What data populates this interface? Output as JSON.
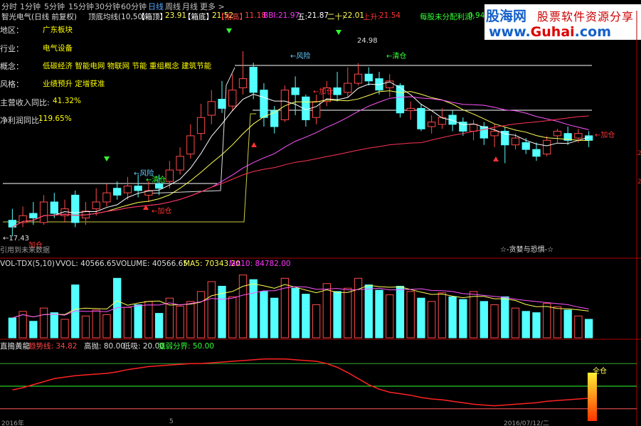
{
  "tabs": [
    "分时",
    "1分钟",
    "5分钟",
    "15分钟",
    "30分钟",
    "60分钟",
    "日线",
    "周线",
    "月线",
    "更多 >"
  ],
  "active_tab": "日线",
  "info_bar": {
    "name": "智光电气(日线 前复权)",
    "formula": "顶底均线(10,50)",
    "top_label": "【箱顶】",
    "top_value": "23.91",
    "bottom_label": "【箱底】",
    "bottom_value": "21.52",
    "target_label": "【指高】",
    "target_value": "11.18",
    "bbi_label": "BBI:",
    "bbi_value": "21.97",
    "five_label": "五:",
    "five_value": "21.87",
    "twenty_label": "二十:",
    "twenty_value": "22.01",
    "up_label": "上升:",
    "up_value": "21.54",
    "dist_label": "每股未分配利润:",
    "dist_value": "0.94"
  },
  "side_info": [
    {
      "key": "地区：",
      "value": "广东板块"
    },
    {
      "key": "行业：",
      "value": "电气设备"
    },
    {
      "key": "概念：",
      "value": "低碳经济 智能电网 物联网 节能 重组概念 建筑节能"
    },
    {
      "key": "风格：",
      "value": "业绩预升 定增获准"
    },
    {
      "key": "主营收入同比:",
      "value": "41.32%"
    },
    {
      "key": "净利润同比:",
      "value": "119.65%"
    }
  ],
  "banner": {
    "site_cn": "股海网",
    "slogan": "股票软件资源分享",
    "url_prefix": "www.",
    "url_main": "Guhai",
    "url_suffix": ".com"
  },
  "annotations": {
    "risk1": "←风险",
    "clear1": "←清仓",
    "add1": "←加仓",
    "risk2": "←风险",
    "add2": "←加仓",
    "clear2": "←清仓",
    "peak": "24.98",
    "low": "←17.43",
    "add_left": "加仓",
    "future": "引用到未来数据",
    "add_right": "←加仓",
    "motto": "☆-贪婪与恐惧-☆"
  },
  "volume_header": {
    "name": "VOL-TDX(5,10)",
    "vvol": "VVOL: 40566.65",
    "volume": "VOLUME: 40566.65",
    "ma5": "MA5: 70343.20",
    "ma10": "MA10: 84782.00"
  },
  "indicator_header": {
    "name": "直搗黃龍",
    "trend": "趋势线: 34.82",
    "high": "高抛: 80.00",
    "low": "低吸: 20.00",
    "strength": "强弱分界: 50.00",
    "full_pos": "全仓"
  },
  "bottom_axis": [
    "2016年",
    "5",
    "2016/07/12/二"
  ],
  "right_axis": [
    "2",
    "2"
  ],
  "chart_data": {
    "type": "candlestick",
    "candles": [
      [
        18.1,
        17.8,
        18.6,
        17.4
      ],
      [
        18.0,
        18.3,
        18.7,
        17.8
      ],
      [
        18.4,
        18.2,
        18.9,
        17.9
      ],
      [
        18.0,
        18.9,
        19.2,
        17.9
      ],
      [
        18.9,
        18.4,
        19.3,
        18.2
      ],
      [
        18.3,
        18.6,
        19.0,
        18.0
      ],
      [
        19.2,
        18.0,
        19.4,
        17.8
      ],
      [
        18.2,
        18.5,
        18.9,
        17.9
      ],
      [
        18.6,
        18.9,
        19.5,
        18.3
      ],
      [
        18.9,
        19.3,
        19.7,
        18.7
      ],
      [
        19.5,
        19.2,
        19.8,
        19.0
      ],
      [
        19.3,
        19.6,
        20.0,
        19.0
      ],
      [
        19.6,
        19.4,
        20.1,
        19.1
      ],
      [
        19.2,
        19.4,
        19.8,
        18.9
      ],
      [
        19.7,
        19.5,
        20.1,
        19.2
      ],
      [
        19.8,
        20.3,
        20.7,
        19.5
      ],
      [
        20.3,
        20.9,
        21.3,
        20.1
      ],
      [
        21.0,
        21.8,
        22.3,
        20.8
      ],
      [
        21.9,
        22.6,
        23.2,
        21.6
      ],
      [
        22.7,
        23.3,
        23.8,
        22.3
      ],
      [
        23.4,
        23.0,
        24.2,
        22.8
      ],
      [
        23.1,
        23.8,
        24.5,
        22.9
      ],
      [
        23.9,
        24.3,
        25.5,
        23.6
      ],
      [
        24.8,
        23.7,
        25.0,
        23.4
      ],
      [
        23.8,
        22.6,
        24.1,
        22.2
      ],
      [
        22.9,
        22.2,
        23.1,
        21.9
      ],
      [
        22.5,
        23.8,
        24.0,
        22.4
      ],
      [
        23.9,
        23.6,
        24.4,
        22.7
      ],
      [
        23.5,
        22.5,
        23.6,
        22.2
      ],
      [
        22.6,
        23.3,
        23.6,
        22.3
      ],
      [
        23.3,
        23.9,
        24.2,
        23.1
      ],
      [
        23.9,
        23.6,
        24.6,
        23.3
      ],
      [
        23.7,
        24.1,
        24.8,
        23.5
      ],
      [
        24.1,
        24.5,
        24.98,
        24.0
      ],
      [
        24.5,
        24.2,
        24.8,
        24.0
      ],
      [
        24.3,
        23.8,
        24.6,
        23.6
      ],
      [
        23.9,
        24.2,
        24.5,
        23.5
      ],
      [
        24.0,
        22.8,
        24.1,
        22.6
      ],
      [
        22.9,
        23.0,
        23.3,
        22.5
      ],
      [
        23.0,
        22.1,
        23.2,
        22.0
      ],
      [
        22.2,
        22.4,
        22.7,
        21.9
      ],
      [
        22.3,
        22.6,
        23.0,
        22.1
      ],
      [
        22.7,
        22.3,
        22.9,
        22.0
      ],
      [
        22.4,
        22.0,
        22.6,
        21.8
      ],
      [
        22.0,
        22.3,
        22.5,
        21.6
      ],
      [
        22.2,
        21.7,
        22.4,
        21.4
      ],
      [
        21.8,
        22.0,
        22.3,
        21.3
      ],
      [
        22.0,
        21.4,
        22.2,
        20.6
      ],
      [
        21.4,
        21.7,
        21.9,
        21.2
      ],
      [
        21.5,
        21.2,
        21.7,
        21.0
      ],
      [
        21.2,
        20.9,
        21.5,
        20.7
      ],
      [
        21.0,
        21.6,
        21.8,
        20.9
      ],
      [
        21.8,
        22.0,
        22.1,
        21.5
      ],
      [
        21.9,
        21.6,
        22.2,
        21.4
      ],
      [
        21.7,
        21.9,
        22.1,
        21.5
      ],
      [
        21.8,
        21.6,
        22.0,
        21.3
      ]
    ],
    "volume": [
      30,
      40,
      25,
      45,
      38,
      28,
      80,
      33,
      42,
      35,
      90,
      46,
      50,
      55,
      37,
      60,
      48,
      55,
      70,
      85,
      78,
      62,
      95,
      88,
      70,
      60,
      90,
      75,
      66,
      50,
      82,
      70,
      75,
      90,
      80,
      72,
      65,
      78,
      70,
      60,
      55,
      68,
      62,
      58,
      70,
      55,
      50,
      62,
      45,
      40,
      38,
      52,
      47,
      42,
      33,
      28
    ],
    "indicator": [
      45,
      48,
      52,
      56,
      60,
      62,
      64,
      65,
      66,
      67,
      69,
      72,
      74,
      76,
      77,
      78,
      79,
      80,
      80,
      81,
      82,
      83,
      84,
      85,
      86,
      86,
      86,
      85,
      84,
      83,
      80,
      75,
      68,
      60,
      52,
      46,
      42,
      40,
      38,
      35,
      33,
      32,
      30,
      28,
      26,
      25,
      24,
      25,
      26,
      27,
      28,
      30,
      31,
      32,
      33,
      34
    ]
  }
}
